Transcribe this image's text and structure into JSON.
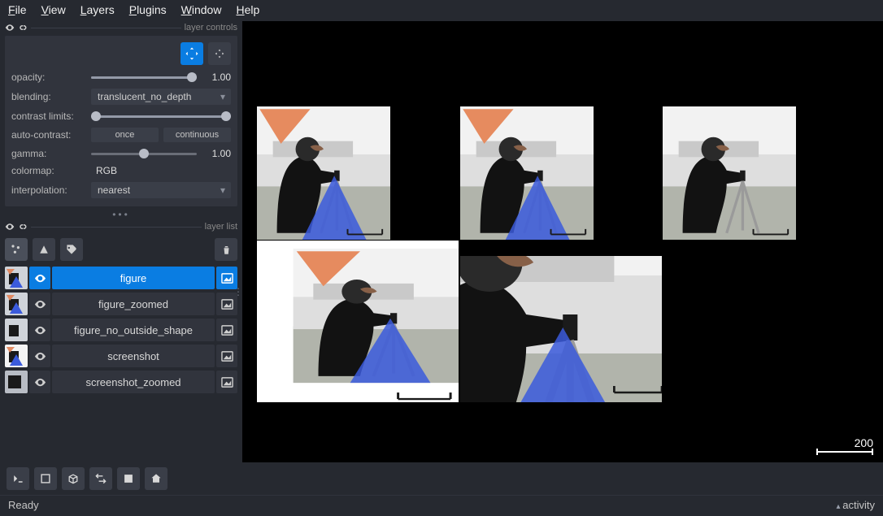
{
  "menu": {
    "file": "File",
    "view": "View",
    "layers": "Layers",
    "plugins": "Plugins",
    "window": "Window",
    "help": "Help"
  },
  "panels": {
    "controls_title": "layer controls",
    "list_title": "layer list"
  },
  "controls": {
    "opacity_label": "opacity:",
    "opacity_value": "1.00",
    "blending_label": "blending:",
    "blending_value": "translucent_no_depth",
    "contrast_label": "contrast limits:",
    "auto_label": "auto-contrast:",
    "auto_once": "once",
    "auto_cont": "continuous",
    "gamma_label": "gamma:",
    "gamma_value": "1.00",
    "colormap_label": "colormap:",
    "colormap_value": "RGB",
    "interp_label": "interpolation:",
    "interp_value": "nearest"
  },
  "layers": [
    {
      "name": "figure",
      "selected": true
    },
    {
      "name": "figure_zoomed",
      "selected": false
    },
    {
      "name": "figure_no_outside_shape",
      "selected": false
    },
    {
      "name": "screenshot",
      "selected": false
    },
    {
      "name": "screenshot_zoomed",
      "selected": false
    }
  ],
  "scale": "200",
  "status": {
    "ready": "Ready",
    "activity": "activity"
  }
}
